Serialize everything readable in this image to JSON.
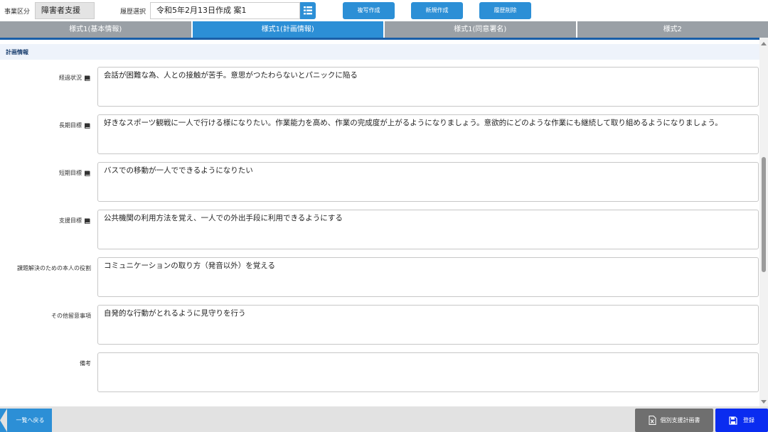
{
  "header": {
    "dept_label": "事業区分",
    "dept_value": "障害者支援",
    "history_label": "履歴選択",
    "history_value": "令和5年2月13日作成  案1",
    "buttons": {
      "copy": "複写作成",
      "new": "新規作成",
      "delete": "履歴削除"
    }
  },
  "tabs": [
    {
      "label": "様式1(基本情報)"
    },
    {
      "label": "様式1(計画情報)"
    },
    {
      "label": "様式1(同意署名)"
    },
    {
      "label": "様式2"
    }
  ],
  "section": {
    "title": "計画情報"
  },
  "fields": [
    {
      "label": "経過状況",
      "value": "会話が困難な為、人との接触が苦手。意思がつたわらないとパニックに陥る",
      "icon": "book-icon"
    },
    {
      "label": "長期目標",
      "value": "好きなスポーツ観戦に一人で行ける様になりたい。作業能力を高め、作業の完成度が上がるようになりましょう。意欲的にどのような作業にも継続して取り組めるようになりましょう。",
      "icon": "book-icon"
    },
    {
      "label": "短期目標",
      "value": "バスでの移動が一人でできるようになりたい",
      "icon": "book-icon"
    },
    {
      "label": "支援目標",
      "value": "公共機関の利用方法を覚え、一人での外出手段に利用できるようにする",
      "icon": "book-icon"
    },
    {
      "label": "課題解決のための本人の役割",
      "value": "コミュニケーションの取り方（発音以外）を覚える"
    },
    {
      "label": "その他留意事項",
      "value": "自発的な行動がとれるように見守りを行う"
    },
    {
      "label": "備考",
      "value": ""
    }
  ],
  "footer": {
    "back": "一覧へ戻る",
    "plan": "個別支援計画書",
    "register": "登録"
  },
  "colors": {
    "accent": "#2c8fd6",
    "tab_inactive": "#9aa0a6",
    "register": "#0a2cf0",
    "plan_button": "#6f6f6f"
  }
}
